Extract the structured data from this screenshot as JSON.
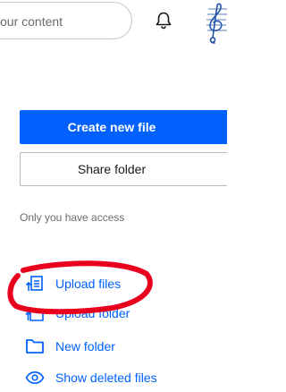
{
  "topbar": {
    "search": {
      "value": "your content"
    },
    "icons": {
      "bell": "bell-icon",
      "avatar": "treble-clef-avatar"
    }
  },
  "sidebar": {
    "primary_button": "Create new file",
    "secondary_button": "Share folder",
    "access_text": "Only you have access",
    "actions": [
      {
        "label": "Upload files",
        "icon": "upload-file-icon"
      },
      {
        "label": "Upload folder",
        "icon": "upload-folder-icon"
      },
      {
        "label": "New folder",
        "icon": "folder-icon"
      },
      {
        "label": "Show deleted files",
        "icon": "eye-icon"
      }
    ]
  },
  "colors": {
    "accent": "#0061fe",
    "annotation": "#e8001c"
  }
}
